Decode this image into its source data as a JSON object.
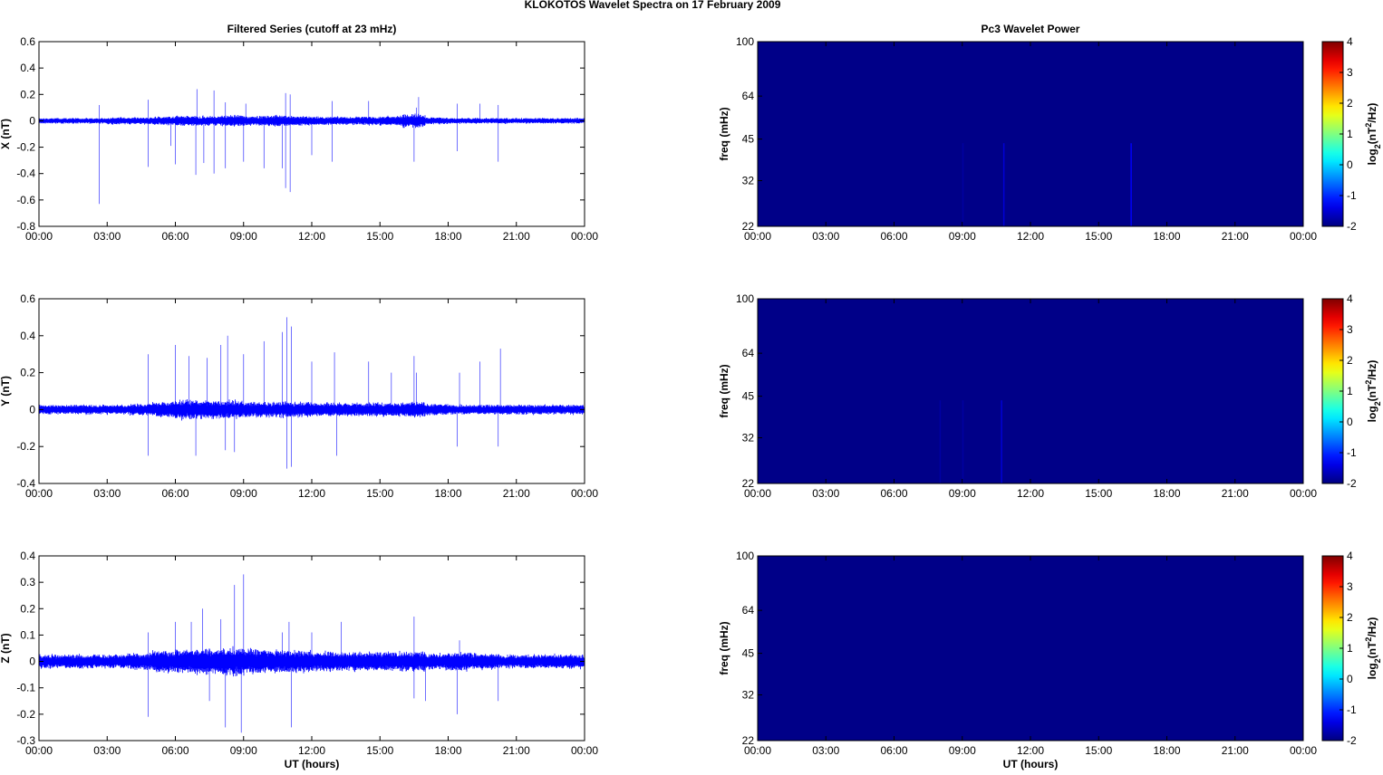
{
  "title": "KLOKOTOS Wavelet Spectra on 17 February  2009",
  "chart_data": [
    {
      "type": "line",
      "title": "Filtered Series (cutoff at 23 mHz)",
      "ylabel": "X (nT)",
      "xlabel": "",
      "xlim": [
        0,
        24
      ],
      "ylim": [
        -0.8,
        0.6
      ],
      "yticks": [
        -0.8,
        -0.6,
        -0.4,
        -0.2,
        0,
        0.2,
        0.4,
        0.6
      ],
      "xtick_labels": [
        "00:00",
        "03:00",
        "06:00",
        "09:00",
        "12:00",
        "15:00",
        "18:00",
        "21:00",
        "00:00"
      ],
      "color": "#0000ff",
      "noise_level_per_hour": [
        0.02,
        0.02,
        0.02,
        0.025,
        0.025,
        0.03,
        0.035,
        0.035,
        0.04,
        0.035,
        0.04,
        0.035,
        0.03,
        0.03,
        0.03,
        0.035,
        0.05,
        0.025,
        0.02,
        0.02,
        0.02,
        0.02,
        0.02,
        0.02
      ],
      "spikes": [
        [
          2.65,
          -0.63
        ],
        [
          2.65,
          0.12
        ],
        [
          4.8,
          -0.35
        ],
        [
          4.8,
          0.16
        ],
        [
          5.8,
          -0.19
        ],
        [
          6.0,
          -0.33
        ],
        [
          6.9,
          -0.41
        ],
        [
          6.95,
          0.24
        ],
        [
          7.25,
          -0.32
        ],
        [
          7.7,
          0.23
        ],
        [
          7.7,
          -0.4
        ],
        [
          8.2,
          -0.36
        ],
        [
          8.2,
          0.14
        ],
        [
          9.0,
          -0.31
        ],
        [
          9.1,
          0.13
        ],
        [
          9.9,
          -0.36
        ],
        [
          10.7,
          -0.36
        ],
        [
          10.85,
          0.21
        ],
        [
          10.85,
          -0.51
        ],
        [
          11.05,
          -0.54
        ],
        [
          11.05,
          0.2
        ],
        [
          12.0,
          -0.26
        ],
        [
          12.9,
          -0.31
        ],
        [
          12.9,
          0.15
        ],
        [
          14.5,
          0.15
        ],
        [
          16.5,
          -0.31
        ],
        [
          16.6,
          0.1
        ],
        [
          16.7,
          0.18
        ],
        [
          18.4,
          -0.23
        ],
        [
          18.4,
          0.13
        ],
        [
          19.4,
          0.13
        ],
        [
          20.2,
          -0.31
        ],
        [
          20.2,
          0.12
        ]
      ]
    },
    {
      "type": "line",
      "title": "",
      "ylabel": "Y (nT)",
      "xlabel": "",
      "xlim": [
        0,
        24
      ],
      "ylim": [
        -0.4,
        0.6
      ],
      "yticks": [
        -0.4,
        -0.2,
        0,
        0.2,
        0.4,
        0.6
      ],
      "xtick_labels": [
        "00:00",
        "03:00",
        "06:00",
        "09:00",
        "12:00",
        "15:00",
        "18:00",
        "21:00",
        "00:00"
      ],
      "color": "#0000ff",
      "noise_level_per_hour": [
        0.025,
        0.025,
        0.025,
        0.025,
        0.03,
        0.04,
        0.05,
        0.045,
        0.045,
        0.04,
        0.04,
        0.04,
        0.035,
        0.035,
        0.035,
        0.035,
        0.04,
        0.03,
        0.025,
        0.025,
        0.025,
        0.025,
        0.025,
        0.025
      ],
      "spikes": [
        [
          4.8,
          0.3
        ],
        [
          4.8,
          -0.25
        ],
        [
          6.0,
          0.35
        ],
        [
          6.6,
          0.29
        ],
        [
          6.9,
          -0.25
        ],
        [
          7.4,
          0.28
        ],
        [
          8.0,
          0.35
        ],
        [
          8.2,
          -0.22
        ],
        [
          8.3,
          0.4
        ],
        [
          8.6,
          -0.23
        ],
        [
          9.0,
          0.3
        ],
        [
          9.9,
          0.37
        ],
        [
          10.7,
          0.42
        ],
        [
          10.9,
          0.5
        ],
        [
          10.9,
          -0.32
        ],
        [
          11.1,
          0.45
        ],
        [
          11.1,
          -0.31
        ],
        [
          12.0,
          0.26
        ],
        [
          13.0,
          0.31
        ],
        [
          13.1,
          -0.25
        ],
        [
          14.5,
          0.26
        ],
        [
          15.5,
          0.2
        ],
        [
          16.5,
          0.29
        ],
        [
          16.6,
          0.2
        ],
        [
          18.4,
          -0.2
        ],
        [
          18.5,
          0.2
        ],
        [
          19.4,
          0.26
        ],
        [
          20.2,
          -0.2
        ],
        [
          20.3,
          0.33
        ]
      ]
    },
    {
      "type": "line",
      "title": "",
      "ylabel": "Z (nT)",
      "xlabel": "UT (hours)",
      "xlim": [
        0,
        24
      ],
      "ylim": [
        -0.3,
        0.4
      ],
      "yticks": [
        -0.3,
        -0.2,
        -0.1,
        0,
        0.1,
        0.2,
        0.3,
        0.4
      ],
      "xtick_labels": [
        "00:00",
        "03:00",
        "06:00",
        "09:00",
        "12:00",
        "15:00",
        "18:00",
        "21:00",
        "00:00"
      ],
      "color": "#0000ff",
      "noise_level_per_hour": [
        0.025,
        0.025,
        0.025,
        0.025,
        0.03,
        0.04,
        0.045,
        0.045,
        0.05,
        0.045,
        0.04,
        0.04,
        0.035,
        0.035,
        0.035,
        0.035,
        0.035,
        0.03,
        0.035,
        0.03,
        0.025,
        0.025,
        0.025,
        0.025
      ],
      "spikes": [
        [
          4.8,
          0.11
        ],
        [
          4.8,
          -0.21
        ],
        [
          6.0,
          0.15
        ],
        [
          6.7,
          0.15
        ],
        [
          7.2,
          0.2
        ],
        [
          7.5,
          -0.15
        ],
        [
          8.0,
          0.16
        ],
        [
          8.2,
          -0.25
        ],
        [
          8.6,
          0.29
        ],
        [
          8.9,
          -0.27
        ],
        [
          9.0,
          0.33
        ],
        [
          10.7,
          0.11
        ],
        [
          11.0,
          0.15
        ],
        [
          11.1,
          -0.25
        ],
        [
          12.0,
          0.11
        ],
        [
          13.3,
          0.15
        ],
        [
          16.5,
          0.17
        ],
        [
          16.5,
          -0.14
        ],
        [
          17.0,
          -0.15
        ],
        [
          18.4,
          -0.2
        ],
        [
          18.5,
          0.08
        ],
        [
          20.2,
          -0.15
        ]
      ]
    },
    {
      "type": "heatmap",
      "title": "Pc3 Wavelet Power",
      "ylabel": "freq (mHz)",
      "xlabel": "",
      "xlim": [
        0,
        24
      ],
      "yticks": [
        22,
        32,
        45,
        64,
        100
      ],
      "ylim": [
        22,
        100
      ],
      "xtick_labels": [
        "00:00",
        "03:00",
        "06:00",
        "09:00",
        "12:00",
        "15:00",
        "18:00",
        "21:00",
        "00:00"
      ],
      "colorbar_label": "log2(nT2/Hz)",
      "colorbar_ticks": [
        -2,
        -1,
        0,
        1,
        2,
        3,
        4
      ],
      "clim": [
        -2,
        4
      ],
      "background_value": -1.95,
      "features": [
        [
          9.0,
          -1.8
        ],
        [
          10.8,
          -1.5
        ],
        [
          16.4,
          -1.3
        ]
      ]
    },
    {
      "type": "heatmap",
      "title": "",
      "ylabel": "freq (mHz)",
      "xlabel": "",
      "xlim": [
        0,
        24
      ],
      "yticks": [
        22,
        32,
        45,
        64,
        100
      ],
      "ylim": [
        22,
        100
      ],
      "xtick_labels": [
        "00:00",
        "03:00",
        "06:00",
        "09:00",
        "12:00",
        "15:00",
        "18:00",
        "21:00",
        "00:00"
      ],
      "colorbar_label": "log2(nT2/Hz)",
      "colorbar_ticks": [
        -2,
        -1,
        0,
        1,
        2,
        3,
        4
      ],
      "clim": [
        -2,
        4
      ],
      "background_value": -1.95,
      "features": [
        [
          8.0,
          -1.8
        ],
        [
          9.0,
          -1.8
        ],
        [
          10.7,
          -1.5
        ]
      ]
    },
    {
      "type": "heatmap",
      "title": "",
      "ylabel": "freq (mHz)",
      "xlabel": "UT (hours)",
      "xlim": [
        0,
        24
      ],
      "yticks": [
        22,
        32,
        45,
        64,
        100
      ],
      "ylim": [
        22,
        100
      ],
      "xtick_labels": [
        "00:00",
        "03:00",
        "06:00",
        "09:00",
        "12:00",
        "15:00",
        "18:00",
        "21:00",
        "00:00"
      ],
      "colorbar_label": "log2(nT2/Hz)",
      "colorbar_ticks": [
        -2,
        -1,
        0,
        1,
        2,
        3,
        4
      ],
      "clim": [
        -2,
        4
      ],
      "background_value": -1.95,
      "features": []
    }
  ]
}
